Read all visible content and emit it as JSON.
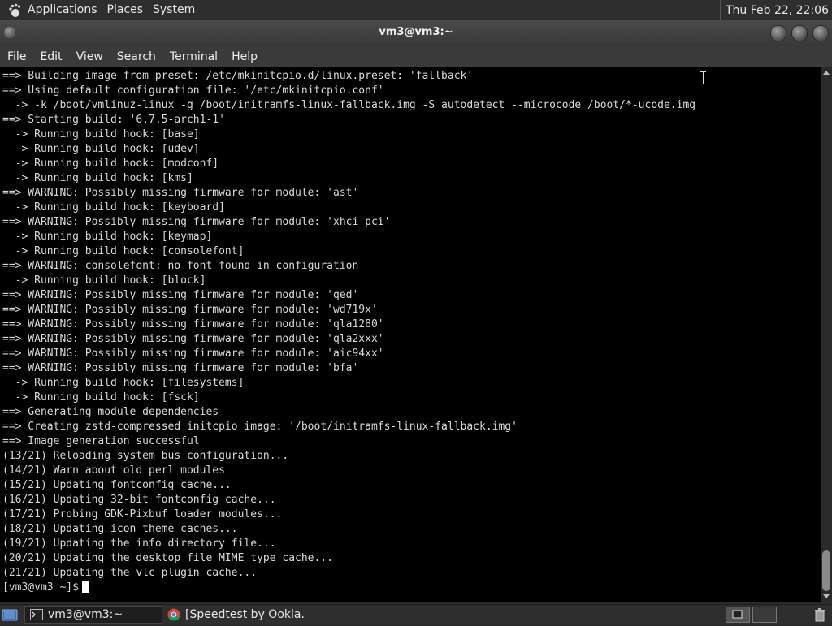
{
  "top_panel": {
    "menus": [
      "Applications",
      "Places",
      "System"
    ],
    "clock": "Thu Feb 22, 22:06",
    "logo_icon": "gnome-foot-icon"
  },
  "window": {
    "title": "vm3@vm3:~"
  },
  "menubar": {
    "items": [
      "File",
      "Edit",
      "View",
      "Search",
      "Terminal",
      "Help"
    ]
  },
  "terminal": {
    "lines": [
      "==> Building image from preset: /etc/mkinitcpio.d/linux.preset: 'fallback'",
      "==> Using default configuration file: '/etc/mkinitcpio.conf'",
      "  -> -k /boot/vmlinuz-linux -g /boot/initramfs-linux-fallback.img -S autodetect --microcode /boot/*-ucode.img",
      "==> Starting build: '6.7.5-arch1-1'",
      "  -> Running build hook: [base]",
      "  -> Running build hook: [udev]",
      "  -> Running build hook: [modconf]",
      "  -> Running build hook: [kms]",
      "==> WARNING: Possibly missing firmware for module: 'ast'",
      "  -> Running build hook: [keyboard]",
      "==> WARNING: Possibly missing firmware for module: 'xhci_pci'",
      "  -> Running build hook: [keymap]",
      "  -> Running build hook: [consolefont]",
      "==> WARNING: consolefont: no font found in configuration",
      "  -> Running build hook: [block]",
      "==> WARNING: Possibly missing firmware for module: 'qed'",
      "==> WARNING: Possibly missing firmware for module: 'wd719x'",
      "==> WARNING: Possibly missing firmware for module: 'qla1280'",
      "==> WARNING: Possibly missing firmware for module: 'qla2xxx'",
      "==> WARNING: Possibly missing firmware for module: 'aic94xx'",
      "==> WARNING: Possibly missing firmware for module: 'bfa'",
      "  -> Running build hook: [filesystems]",
      "  -> Running build hook: [fsck]",
      "==> Generating module dependencies",
      "==> Creating zstd-compressed initcpio image: '/boot/initramfs-linux-fallback.img'",
      "==> Image generation successful",
      "(13/21) Reloading system bus configuration...",
      "(14/21) Warn about old perl modules",
      "(15/21) Updating fontconfig cache...",
      "(16/21) Updating 32-bit fontconfig cache...",
      "(17/21) Probing GDK-Pixbuf loader modules...",
      "(18/21) Updating icon theme caches...",
      "(19/21) Updating the info directory file...",
      "(20/21) Updating the desktop file MIME type cache...",
      "(21/21) Updating the vlc plugin cache..."
    ],
    "prompt": "[vm3@vm3 ~]$"
  },
  "taskbar": {
    "tasks": [
      {
        "label": "vm3@vm3:~",
        "icon": "terminal-icon",
        "active": true
      },
      {
        "label": "[Speedtest by Ookla...",
        "icon": "chrome-icon",
        "active": false
      }
    ]
  },
  "colors": {
    "panel": "#2e2e2e",
    "terminal_bg": "#000000",
    "terminal_fg": "#d8d8d8"
  }
}
